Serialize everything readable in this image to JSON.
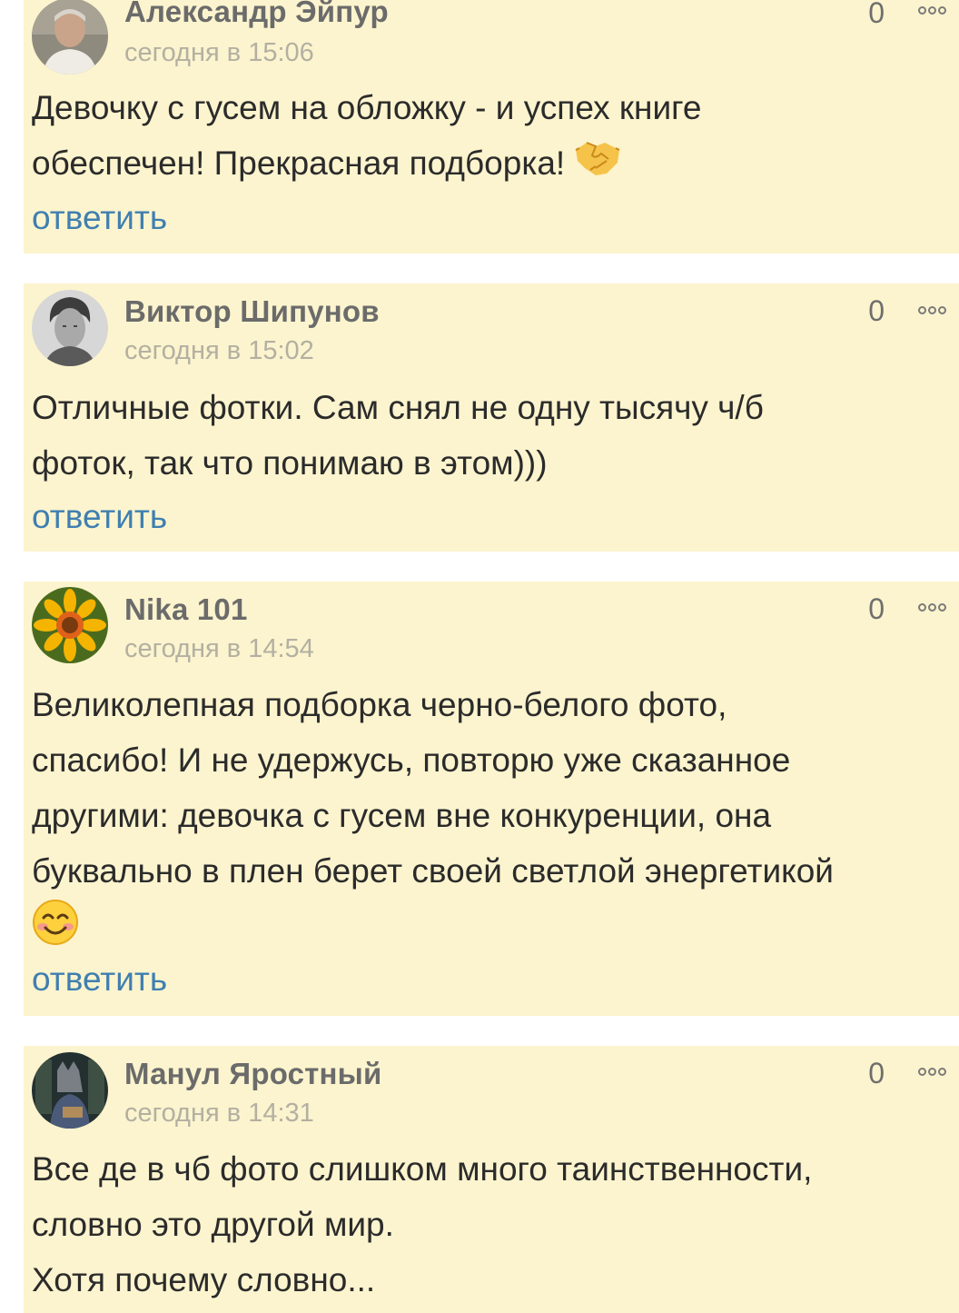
{
  "comments": [
    {
      "author": "Александр Эйпур",
      "time": "сегодня в 15:06",
      "likes": "0",
      "lines": [
        "Девочку с гусем на обложку - и успех книге",
        "обеспечен! Прекрасная подборка!"
      ],
      "emoji": "handshake-emoji",
      "reply": "ответить"
    },
    {
      "author": "Виктор Шипунов",
      "time": "сегодня в 15:02",
      "likes": "0",
      "lines": [
        "Отличные фотки. Сам снял не одну тысячу ч/б",
        "фоток, так что понимаю в этом)))"
      ],
      "reply": "ответить"
    },
    {
      "author": "Nika 101",
      "time": "сегодня в 14:54",
      "likes": "0",
      "lines": [
        "Великолепная подборка черно-белого фото,",
        "спасибо! И не удержусь, повторю уже сказанное",
        "другими: девочка с гусем вне конкуренции, она",
        "буквально в плен берет своей светлой энергетикой"
      ],
      "emoji": "smiling-face-emoji",
      "reply": "ответить"
    },
    {
      "author": "Манул Яростный",
      "time": "сегодня в 14:31",
      "likes": "0",
      "lines": [
        "Все де в чб фото слишком много таинственности,",
        "словно это другой мир.",
        "Хотя почему словно..."
      ]
    }
  ],
  "colors": {
    "card_bg": "#fcf4ce",
    "author": "#6b6b6b",
    "time": "#b3b0a2",
    "reply": "#3f7fb0",
    "text": "#2b2b2b"
  }
}
